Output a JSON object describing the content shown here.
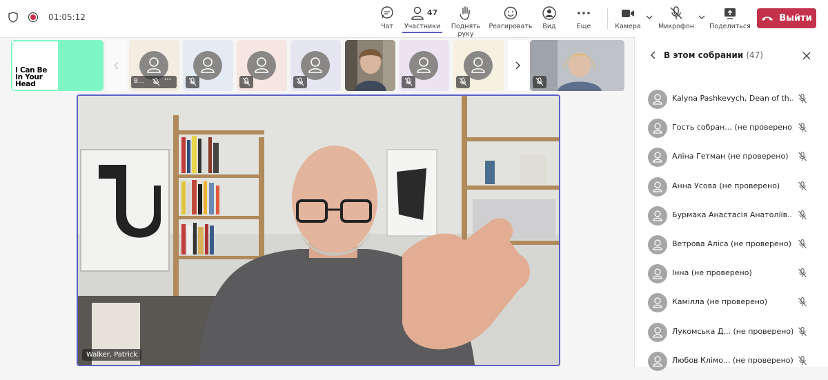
{
  "call": {
    "timer": "01:05:12",
    "participant_count": "47"
  },
  "toolbar": {
    "chat": "Чат",
    "participants": "Участники",
    "raise_hand": "Поднять руку",
    "react": "Реагировать",
    "view": "Вид",
    "more": "Еще",
    "camera": "Камера",
    "mic": "Микрофон",
    "share": "Поделиться",
    "leave": "Выйти"
  },
  "strip": {
    "shared_content_text": [
      "I Can Be",
      "In Your",
      "Head"
    ],
    "first_tile_label": "В...",
    "tile_colors": [
      "#f3ece1",
      "#e4ebf4",
      "#f6e5e0",
      "#e6e6f2",
      "#ece3f2",
      "#f5f0df"
    ]
  },
  "main_video": {
    "name": "Walker, Patrick"
  },
  "panel": {
    "title": "В этом собрании",
    "count": "(47)",
    "participants": [
      "Kalyna Pashkevych, Dean of th...",
      "Гость собран... (не проверено)",
      "Аліна Гетман (не проверено)",
      "Анна Усова (не проверено)",
      "Бурмака Анастасія Анатоліїв...",
      "Ветрова Аліса (не проверено)",
      "Інна (не проверено)",
      "Камілла (не проверено)",
      "Лукомська Д... (не проверено)",
      "Любов Клімо... (не проверено)"
    ]
  },
  "colors": {
    "accent": "#5b5fc7",
    "leave_red": "#c4314b",
    "share_bg": "#7ff7c4"
  }
}
